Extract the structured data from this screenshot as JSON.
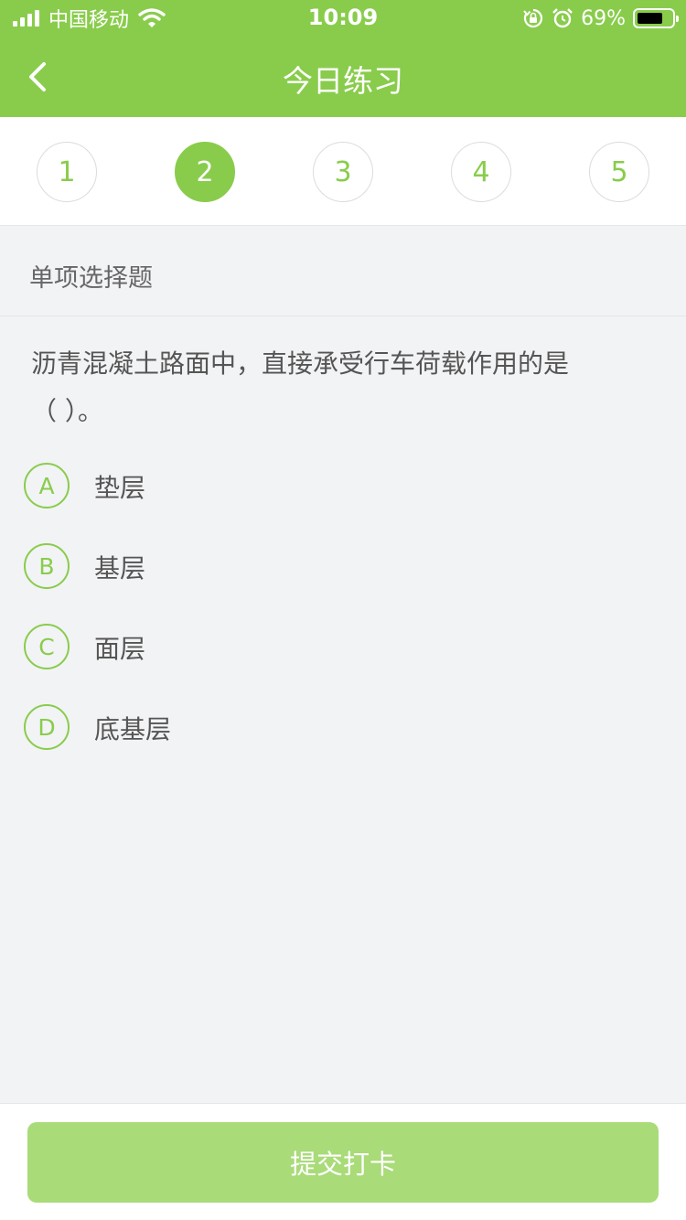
{
  "status_bar": {
    "carrier": "中国移动",
    "time": "10:09",
    "battery": "69%",
    "icons": [
      "signal-icon",
      "wifi-icon",
      "rotation-lock-icon",
      "alarm-icon",
      "battery-icon"
    ]
  },
  "nav": {
    "title": "今日练习",
    "back_icon": "chevron-left-icon"
  },
  "numbers": [
    {
      "label": "1"
    },
    {
      "label": "2",
      "active": true
    },
    {
      "label": "3"
    },
    {
      "label": "4"
    },
    {
      "label": "5"
    }
  ],
  "question": {
    "type": "单项选择题",
    "stem_line1": "沥青混凝土路面中，直接承受行车荷载作用的是",
    "stem_line2": "（    ）。",
    "options": [
      {
        "letter": "A",
        "text": "垫层"
      },
      {
        "letter": "B",
        "text": "基层"
      },
      {
        "letter": "C",
        "text": "面层"
      },
      {
        "letter": "D",
        "text": "底基层"
      }
    ]
  },
  "footer": {
    "submit_label": "提交打卡"
  },
  "colors": {
    "brand": "#89cc4c",
    "button": "#a9db79",
    "background": "#f2f3f5"
  }
}
